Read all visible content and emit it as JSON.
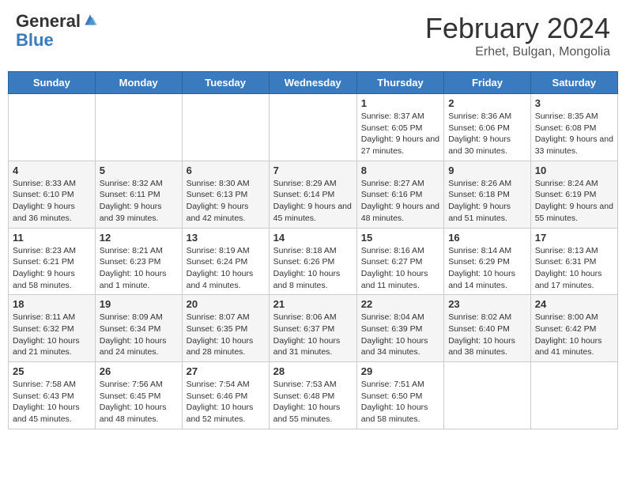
{
  "header": {
    "logo_general": "General",
    "logo_blue": "Blue",
    "month_title": "February 2024",
    "location": "Erhet, Bulgan, Mongolia"
  },
  "weekdays": [
    "Sunday",
    "Monday",
    "Tuesday",
    "Wednesday",
    "Thursday",
    "Friday",
    "Saturday"
  ],
  "weeks": [
    [
      {
        "day": "",
        "info": ""
      },
      {
        "day": "",
        "info": ""
      },
      {
        "day": "",
        "info": ""
      },
      {
        "day": "",
        "info": ""
      },
      {
        "day": "1",
        "info": "Sunrise: 8:37 AM\nSunset: 6:05 PM\nDaylight: 9 hours and 27 minutes."
      },
      {
        "day": "2",
        "info": "Sunrise: 8:36 AM\nSunset: 6:06 PM\nDaylight: 9 hours and 30 minutes."
      },
      {
        "day": "3",
        "info": "Sunrise: 8:35 AM\nSunset: 6:08 PM\nDaylight: 9 hours and 33 minutes."
      }
    ],
    [
      {
        "day": "4",
        "info": "Sunrise: 8:33 AM\nSunset: 6:10 PM\nDaylight: 9 hours and 36 minutes."
      },
      {
        "day": "5",
        "info": "Sunrise: 8:32 AM\nSunset: 6:11 PM\nDaylight: 9 hours and 39 minutes."
      },
      {
        "day": "6",
        "info": "Sunrise: 8:30 AM\nSunset: 6:13 PM\nDaylight: 9 hours and 42 minutes."
      },
      {
        "day": "7",
        "info": "Sunrise: 8:29 AM\nSunset: 6:14 PM\nDaylight: 9 hours and 45 minutes."
      },
      {
        "day": "8",
        "info": "Sunrise: 8:27 AM\nSunset: 6:16 PM\nDaylight: 9 hours and 48 minutes."
      },
      {
        "day": "9",
        "info": "Sunrise: 8:26 AM\nSunset: 6:18 PM\nDaylight: 9 hours and 51 minutes."
      },
      {
        "day": "10",
        "info": "Sunrise: 8:24 AM\nSunset: 6:19 PM\nDaylight: 9 hours and 55 minutes."
      }
    ],
    [
      {
        "day": "11",
        "info": "Sunrise: 8:23 AM\nSunset: 6:21 PM\nDaylight: 9 hours and 58 minutes."
      },
      {
        "day": "12",
        "info": "Sunrise: 8:21 AM\nSunset: 6:23 PM\nDaylight: 10 hours and 1 minute."
      },
      {
        "day": "13",
        "info": "Sunrise: 8:19 AM\nSunset: 6:24 PM\nDaylight: 10 hours and 4 minutes."
      },
      {
        "day": "14",
        "info": "Sunrise: 8:18 AM\nSunset: 6:26 PM\nDaylight: 10 hours and 8 minutes."
      },
      {
        "day": "15",
        "info": "Sunrise: 8:16 AM\nSunset: 6:27 PM\nDaylight: 10 hours and 11 minutes."
      },
      {
        "day": "16",
        "info": "Sunrise: 8:14 AM\nSunset: 6:29 PM\nDaylight: 10 hours and 14 minutes."
      },
      {
        "day": "17",
        "info": "Sunrise: 8:13 AM\nSunset: 6:31 PM\nDaylight: 10 hours and 17 minutes."
      }
    ],
    [
      {
        "day": "18",
        "info": "Sunrise: 8:11 AM\nSunset: 6:32 PM\nDaylight: 10 hours and 21 minutes."
      },
      {
        "day": "19",
        "info": "Sunrise: 8:09 AM\nSunset: 6:34 PM\nDaylight: 10 hours and 24 minutes."
      },
      {
        "day": "20",
        "info": "Sunrise: 8:07 AM\nSunset: 6:35 PM\nDaylight: 10 hours and 28 minutes."
      },
      {
        "day": "21",
        "info": "Sunrise: 8:06 AM\nSunset: 6:37 PM\nDaylight: 10 hours and 31 minutes."
      },
      {
        "day": "22",
        "info": "Sunrise: 8:04 AM\nSunset: 6:39 PM\nDaylight: 10 hours and 34 minutes."
      },
      {
        "day": "23",
        "info": "Sunrise: 8:02 AM\nSunset: 6:40 PM\nDaylight: 10 hours and 38 minutes."
      },
      {
        "day": "24",
        "info": "Sunrise: 8:00 AM\nSunset: 6:42 PM\nDaylight: 10 hours and 41 minutes."
      }
    ],
    [
      {
        "day": "25",
        "info": "Sunrise: 7:58 AM\nSunset: 6:43 PM\nDaylight: 10 hours and 45 minutes."
      },
      {
        "day": "26",
        "info": "Sunrise: 7:56 AM\nSunset: 6:45 PM\nDaylight: 10 hours and 48 minutes."
      },
      {
        "day": "27",
        "info": "Sunrise: 7:54 AM\nSunset: 6:46 PM\nDaylight: 10 hours and 52 minutes."
      },
      {
        "day": "28",
        "info": "Sunrise: 7:53 AM\nSunset: 6:48 PM\nDaylight: 10 hours and 55 minutes."
      },
      {
        "day": "29",
        "info": "Sunrise: 7:51 AM\nSunset: 6:50 PM\nDaylight: 10 hours and 58 minutes."
      },
      {
        "day": "",
        "info": ""
      },
      {
        "day": "",
        "info": ""
      }
    ]
  ]
}
